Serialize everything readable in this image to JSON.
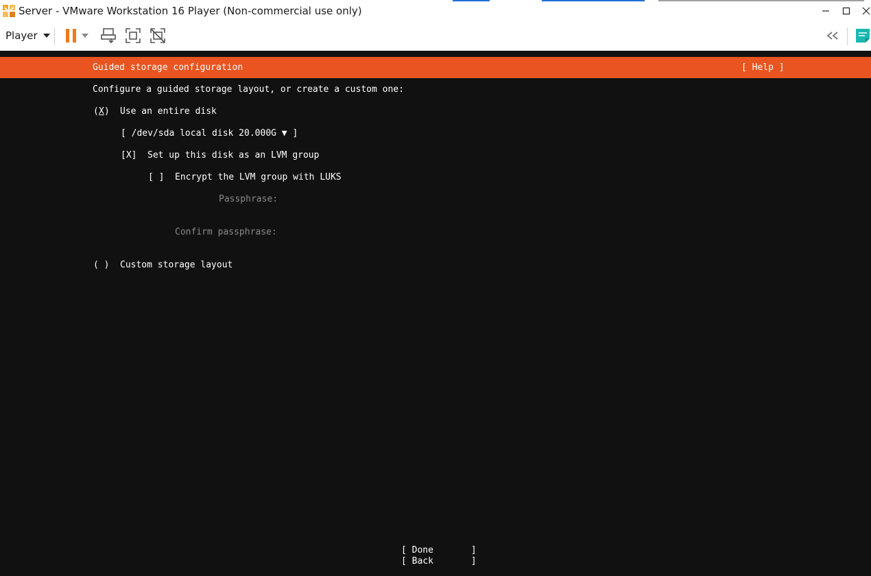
{
  "window": {
    "title": "Server - VMware Workstation 16 Player (Non-commercial use only)",
    "minimize_icon": "minimize-icon",
    "maximize_icon": "maximize-icon",
    "close_icon": "close-icon"
  },
  "toolbar": {
    "player_label": "Player",
    "icons": [
      "pause-icon",
      "dropdown-arrow-icon",
      "send-ctrl-alt-del-icon",
      "full-screen-icon",
      "unity-icon",
      "collapse-icon",
      "message-icon"
    ]
  },
  "installer": {
    "header_title": "Guided storage configuration",
    "help_button": "[ Help ]",
    "intro": "Configure a guided storage layout, or create a custom one:",
    "entire_disk": {
      "mark_open": "(",
      "mark": "X",
      "mark_close": ")",
      "label": "Use an entire disk"
    },
    "disk_select": {
      "value": "[ /dev/sda local disk 20.000G ▼ ]"
    },
    "lvm": {
      "mark": "[X]",
      "label": "Set up this disk as an LVM group"
    },
    "luks": {
      "mark": "[ ]",
      "label": "Encrypt the LVM group with LUKS"
    },
    "passphrase_label": "Passphrase:",
    "confirm_label": "Confirm passphrase:",
    "custom": {
      "mark": "( )",
      "label": "Custom storage layout"
    },
    "done_button": "[ Done       ]",
    "back_button": "[ Back       ]"
  },
  "colors": {
    "accent_orange": "#e95420",
    "console_bg": "#111111",
    "pause_orange": "#f07a1a",
    "note_teal": "#19b8b0"
  }
}
